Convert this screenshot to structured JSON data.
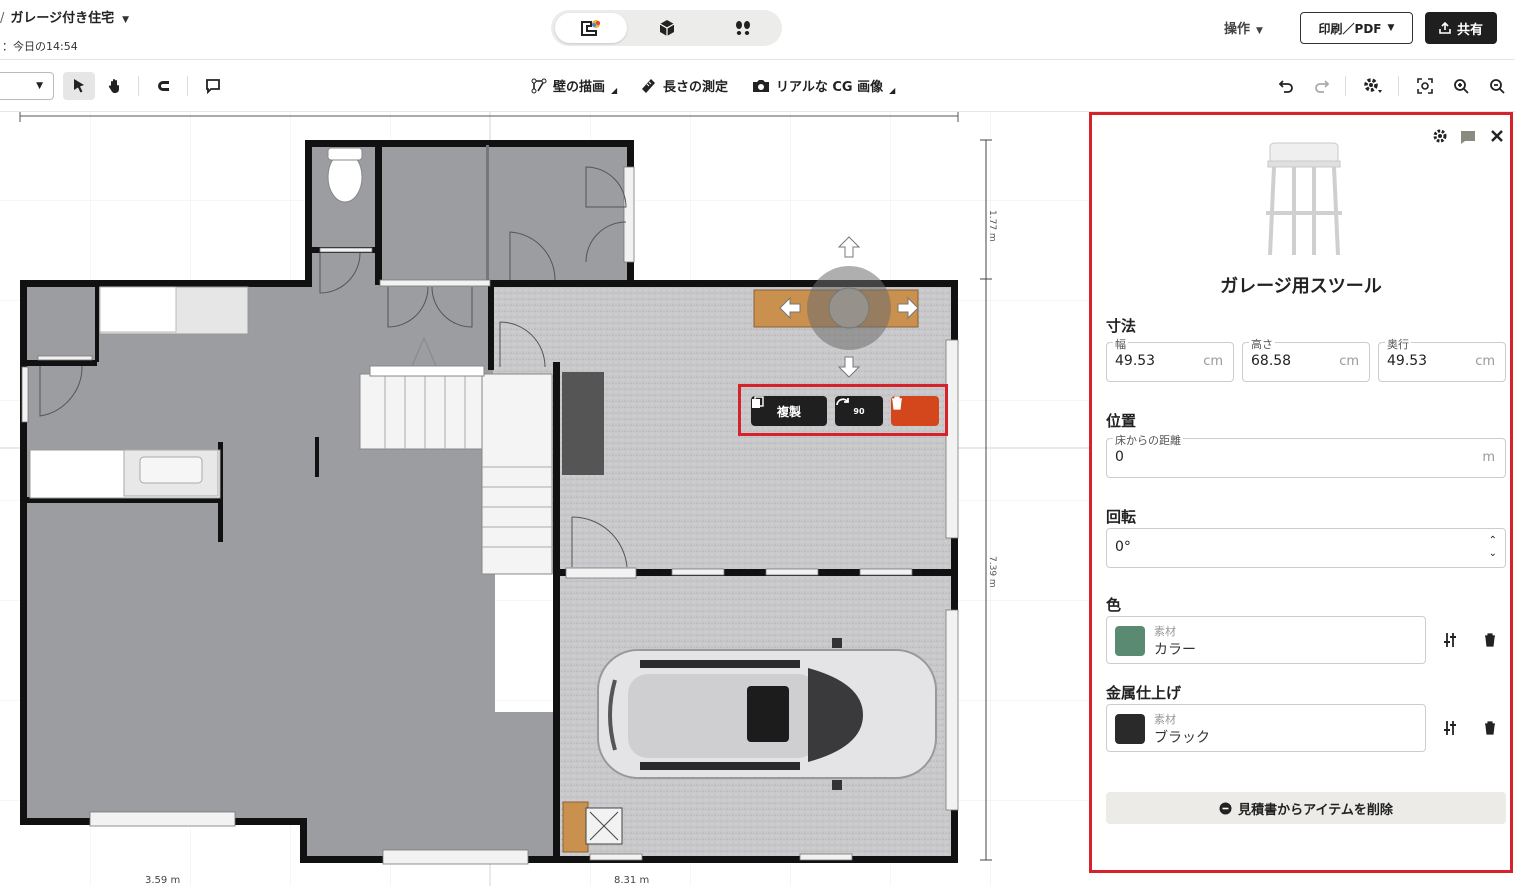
{
  "header": {
    "breadcrumb_sep": "/",
    "project_title": "ガレージ付き住宅",
    "save_status": "：今日の14:54",
    "ops_label": "操作",
    "print_label": "印刷／PDF",
    "share_label": "共有"
  },
  "toolbar": {
    "draw_walls": "壁の描画",
    "measure": "長さの測定",
    "cg_image": "リアルな CG 画像"
  },
  "canvas": {
    "dim_bottom_left": "3.59 m",
    "dim_bottom_mid": "8.31 m",
    "dim_right_top": "1.77 m",
    "dim_right_mid": "7.39 m",
    "duplicate_label": "複製",
    "rotate_label": "90"
  },
  "panel": {
    "item_name": "ガレージ用スツール",
    "dimensions": {
      "title": "寸法",
      "width": {
        "label": "幅",
        "value": "49.53",
        "unit": "cm"
      },
      "height": {
        "label": "高さ",
        "value": "68.58",
        "unit": "cm"
      },
      "depth": {
        "label": "奥行",
        "value": "49.53",
        "unit": "cm"
      }
    },
    "position": {
      "title": "位置",
      "floor_distance": {
        "label": "床からの距離",
        "value": "0",
        "unit": "m"
      }
    },
    "rotation": {
      "title": "回転",
      "value": "0°"
    },
    "color": {
      "title": "色",
      "sub": "素材",
      "value": "カラー",
      "swatch": "#5b8a73"
    },
    "metal": {
      "title": "金属仕上げ",
      "sub": "素材",
      "value": "ブラック",
      "swatch": "#2a2a2a"
    },
    "remove_label": "見積書からアイテムを削除"
  },
  "colors": {
    "accent_red": "#d6222a",
    "delete_orange": "#d4471c",
    "dark_button": "#1f1f1f"
  }
}
